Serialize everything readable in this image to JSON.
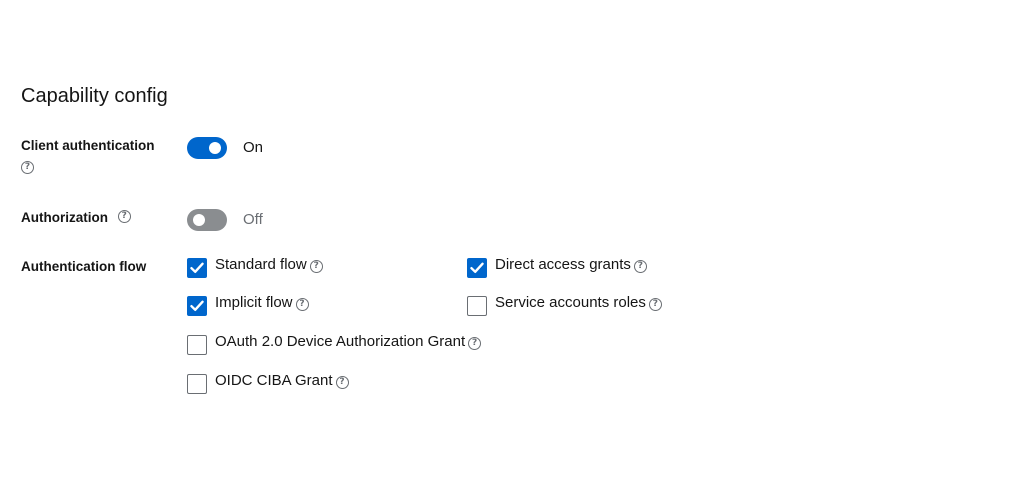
{
  "section": {
    "title": "Capability config"
  },
  "client_authentication": {
    "label": "Client authentication",
    "help_glyph": "?",
    "toggle_text": "On",
    "enabled": true,
    "color": "#0066cc"
  },
  "authorization": {
    "label": "Authorization",
    "help_glyph": "?",
    "toggle_text": "Off",
    "enabled": false,
    "color": "#8a8d90"
  },
  "authentication_flow": {
    "label": "Authentication flow",
    "options": [
      {
        "label": "Standard flow",
        "checked": true,
        "help_glyph": "?"
      },
      {
        "label": "Direct access grants",
        "checked": true,
        "help_glyph": "?"
      },
      {
        "label": "Implicit flow",
        "checked": true,
        "help_glyph": "?"
      },
      {
        "label": "Service accounts roles",
        "checked": false,
        "help_glyph": "?"
      },
      {
        "label": "OAuth 2.0 Device Authorization Grant",
        "checked": false,
        "help_glyph": "?"
      },
      {
        "label": "OIDC CIBA Grant",
        "checked": false,
        "help_glyph": "?"
      }
    ]
  },
  "icons": {
    "help": "question-circle-icon",
    "check": "checkmark-icon"
  }
}
